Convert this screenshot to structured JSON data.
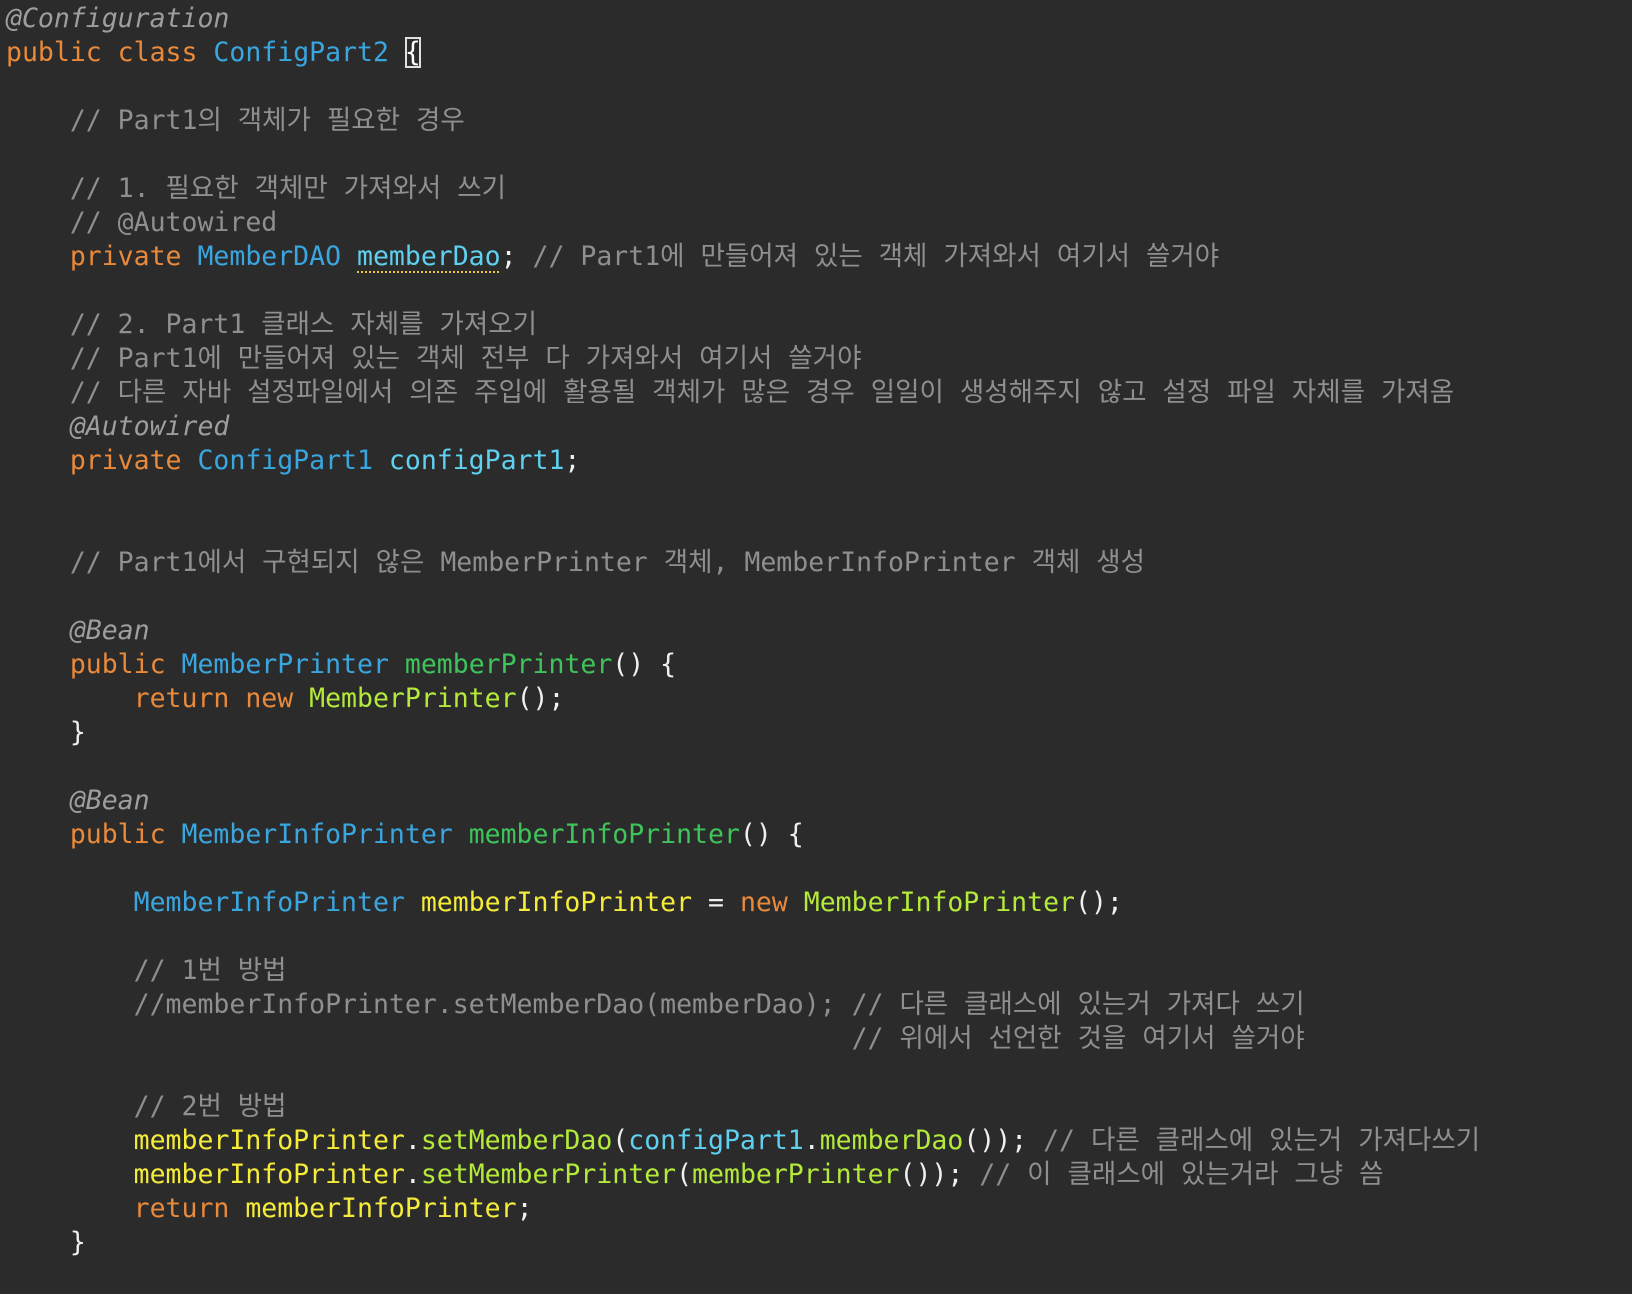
{
  "editor": {
    "lines": [
      {
        "segments": [
          {
            "t": "@Configuration",
            "c": "ann"
          }
        ]
      },
      {
        "segments": [
          {
            "t": "public class ",
            "c": "kw"
          },
          {
            "t": "ConfigPart2 ",
            "c": "type"
          },
          {
            "t": "{",
            "c": "brace-match"
          }
        ]
      },
      {
        "segments": []
      },
      {
        "segments": [
          {
            "t": "    // Part1의 객체가 필요한 경우",
            "c": "cmt"
          }
        ]
      },
      {
        "segments": []
      },
      {
        "segments": [
          {
            "t": "    // 1. 필요한 객체만 가져와서 쓰기",
            "c": "cmt"
          }
        ]
      },
      {
        "segments": [
          {
            "t": "    // @Autowired",
            "c": "cmt"
          }
        ]
      },
      {
        "segments": [
          {
            "t": "    private ",
            "c": "kw"
          },
          {
            "t": "MemberDAO ",
            "c": "type"
          },
          {
            "t": "memberDao",
            "c": "field warn"
          },
          {
            "t": "; ",
            "c": "punct"
          },
          {
            "t": "// Part1에 만들어져 있는 객체 가져와서 여기서 쓸거야",
            "c": "cmt"
          }
        ]
      },
      {
        "segments": []
      },
      {
        "segments": [
          {
            "t": "    // 2. Part1 클래스 자체를 가져오기",
            "c": "cmt"
          }
        ]
      },
      {
        "segments": [
          {
            "t": "    // Part1에 만들어져 있는 객체 전부 다 가져와서 여기서 쓸거야",
            "c": "cmt"
          }
        ]
      },
      {
        "segments": [
          {
            "t": "    // 다른 자바 설정파일에서 의존 주입에 활용될 객체가 많은 경우 일일이 생성해주지 않고 설정 파일 자체를 가져옴",
            "c": "cmt"
          }
        ]
      },
      {
        "segments": [
          {
            "t": "    @Autowired",
            "c": "ann"
          }
        ]
      },
      {
        "segments": [
          {
            "t": "    private ",
            "c": "kw"
          },
          {
            "t": "ConfigPart1 ",
            "c": "type"
          },
          {
            "t": "configPart1",
            "c": "field"
          },
          {
            "t": ";",
            "c": "punct"
          }
        ]
      },
      {
        "segments": []
      },
      {
        "segments": []
      },
      {
        "segments": [
          {
            "t": "    // Part1에서 구현되지 않은 MemberPrinter 객체, MemberInfoPrinter 객체 생성",
            "c": "cmt"
          }
        ]
      },
      {
        "segments": []
      },
      {
        "segments": [
          {
            "t": "    @Bean",
            "c": "ann"
          }
        ]
      },
      {
        "segments": [
          {
            "t": "    public ",
            "c": "kw"
          },
          {
            "t": "MemberPrinter ",
            "c": "type"
          },
          {
            "t": "memberPrinter",
            "c": "method-def"
          },
          {
            "t": "() {",
            "c": "punct"
          }
        ]
      },
      {
        "segments": [
          {
            "t": "        return new ",
            "c": "kw"
          },
          {
            "t": "MemberPrinter",
            "c": "call"
          },
          {
            "t": "();",
            "c": "punct"
          }
        ]
      },
      {
        "segments": [
          {
            "t": "    }",
            "c": "punct"
          }
        ]
      },
      {
        "segments": []
      },
      {
        "segments": [
          {
            "t": "    @Bean",
            "c": "ann"
          }
        ]
      },
      {
        "segments": [
          {
            "t": "    public ",
            "c": "kw"
          },
          {
            "t": "MemberInfoPrinter ",
            "c": "type"
          },
          {
            "t": "memberInfoPrinter",
            "c": "method-def"
          },
          {
            "t": "() {",
            "c": "punct"
          }
        ]
      },
      {
        "segments": []
      },
      {
        "segments": [
          {
            "t": "        ",
            "c": "punct"
          },
          {
            "t": "MemberInfoPrinter ",
            "c": "type"
          },
          {
            "t": "memberInfoPrinter",
            "c": "var"
          },
          {
            "t": " = ",
            "c": "punct"
          },
          {
            "t": "new ",
            "c": "kw"
          },
          {
            "t": "MemberInfoPrinter",
            "c": "call"
          },
          {
            "t": "();",
            "c": "punct"
          }
        ]
      },
      {
        "segments": []
      },
      {
        "segments": [
          {
            "t": "        // 1번 방법",
            "c": "cmt"
          }
        ]
      },
      {
        "segments": [
          {
            "t": "        //memberInfoPrinter.setMemberDao(memberDao); // 다른 클래스에 있는거 가져다 쓰기",
            "c": "cmt"
          }
        ]
      },
      {
        "segments": [
          {
            "t": "                                                     // 위에서 선언한 것을 여기서 쓸거야",
            "c": "cmt"
          }
        ]
      },
      {
        "segments": []
      },
      {
        "segments": [
          {
            "t": "        // 2번 방법",
            "c": "cmt"
          }
        ]
      },
      {
        "segments": [
          {
            "t": "        memberInfoPrinter",
            "c": "var"
          },
          {
            "t": ".",
            "c": "punct"
          },
          {
            "t": "setMemberDao",
            "c": "call"
          },
          {
            "t": "(",
            "c": "punct"
          },
          {
            "t": "configPart1",
            "c": "field"
          },
          {
            "t": ".",
            "c": "punct"
          },
          {
            "t": "memberDao",
            "c": "call"
          },
          {
            "t": "()); ",
            "c": "punct"
          },
          {
            "t": "// 다른 클래스에 있는거 가져다쓰기",
            "c": "cmt"
          }
        ]
      },
      {
        "segments": [
          {
            "t": "        memberInfoPrinter",
            "c": "var"
          },
          {
            "t": ".",
            "c": "punct"
          },
          {
            "t": "setMemberPrinter",
            "c": "call"
          },
          {
            "t": "(",
            "c": "punct"
          },
          {
            "t": "memberPrinter",
            "c": "call"
          },
          {
            "t": "()); ",
            "c": "punct"
          },
          {
            "t": "// 이 클래스에 있는거라 그냥 씀",
            "c": "cmt"
          }
        ]
      },
      {
        "segments": [
          {
            "t": "        return ",
            "c": "kw"
          },
          {
            "t": "memberInfoPrinter",
            "c": "var"
          },
          {
            "t": ";",
            "c": "punct"
          }
        ]
      },
      {
        "segments": [
          {
            "t": "    }",
            "c": "punct"
          }
        ]
      }
    ]
  },
  "colors": {
    "background": "#2b2b2b",
    "annotation": "#9e9e9e",
    "keyword": "#e9893a",
    "type": "#3aa6df",
    "field": "#5fd1f0",
    "method_definition": "#3ec45a",
    "method_call": "#b4ea3a",
    "local_variable": "#f5ec3a",
    "comment": "#8f8f8f"
  }
}
